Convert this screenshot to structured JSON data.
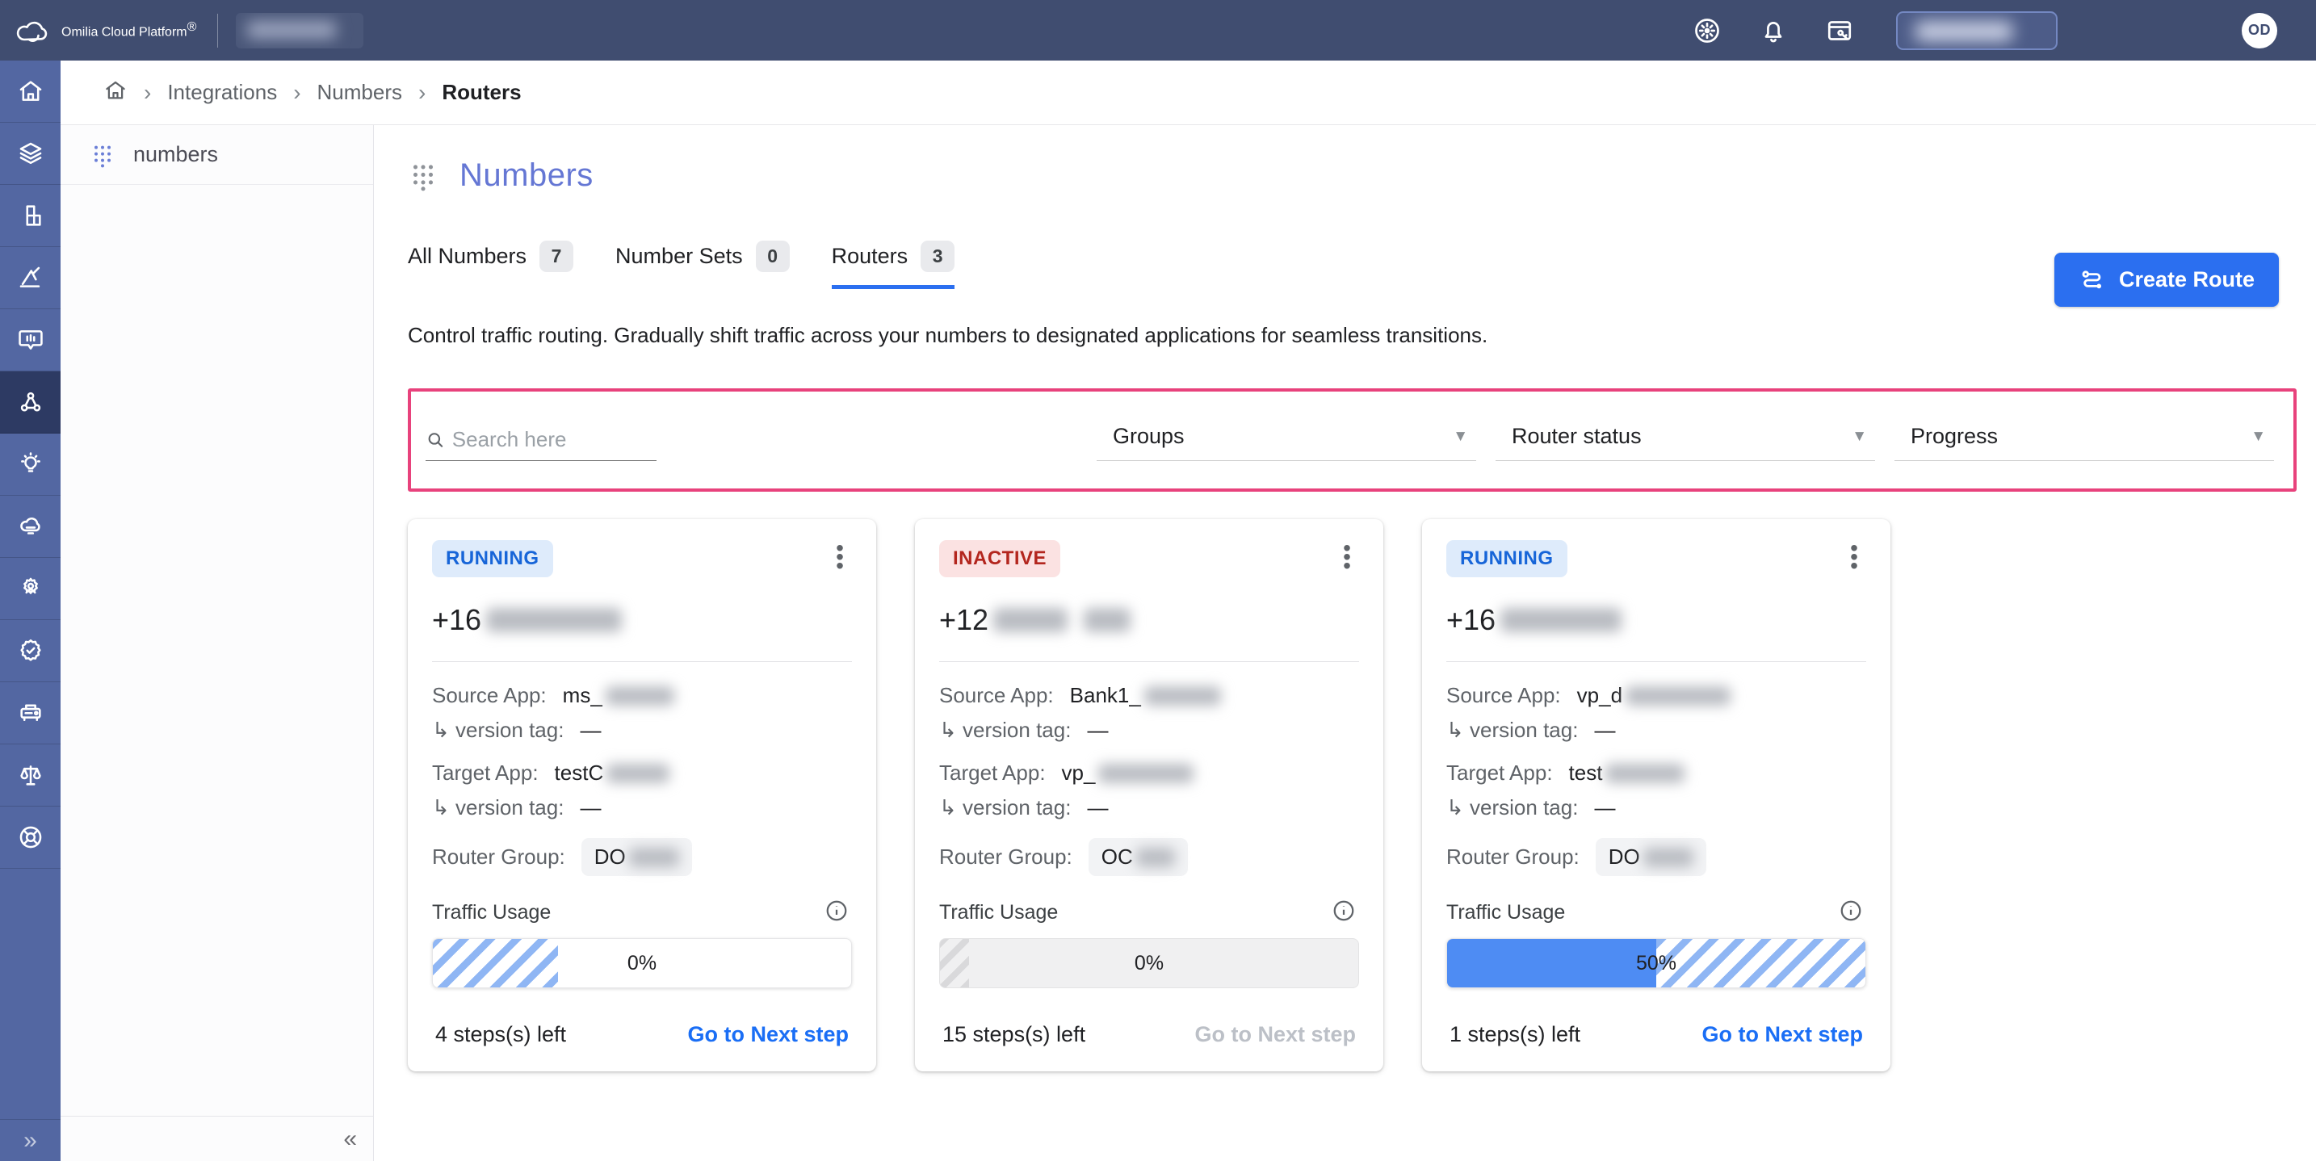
{
  "topbar": {
    "brand": "Omilia Cloud Platform",
    "brand_mark": "®",
    "avatar_initials": "OD",
    "icons": [
      "apps-wheel",
      "notifications-bell",
      "window-key"
    ]
  },
  "breadcrumb": {
    "separator": "›",
    "items": [
      "Integrations",
      "Numbers",
      "Routers"
    ]
  },
  "rail": {
    "icons": [
      "home",
      "layers",
      "blocks",
      "vector-triangle",
      "chat-insights",
      "network",
      "lightbulb",
      "cloud",
      "user-gear",
      "badge-check",
      "machine",
      "scales",
      "lifebuoy"
    ],
    "active": "network",
    "expand_glyph": "»"
  },
  "subsidebar": {
    "title": "numbers",
    "collapse_glyph": "«"
  },
  "page": {
    "title": "Numbers",
    "tabs": [
      {
        "label": "All Numbers",
        "count": "7"
      },
      {
        "label": "Number Sets",
        "count": "0"
      },
      {
        "label": "Routers",
        "count": "3"
      }
    ],
    "active_tab": "Routers",
    "description": "Control traffic routing. Gradually shift traffic across your numbers to designated applications for seamless transitions.",
    "create_button": "Create Route"
  },
  "filters": {
    "search_placeholder": "Search here",
    "groups_label": "Groups",
    "status_label": "Router status",
    "progress_label": "Progress",
    "arrow_glyph": "▼",
    "highlight_color": "#e8427c"
  },
  "card_labels": {
    "source": "Source App:",
    "target": "Target App:",
    "version_arrow": "↳",
    "version": "version tag:",
    "dash": "—",
    "group": "Router Group:",
    "traffic": "Traffic Usage"
  },
  "cards": [
    {
      "status": "RUNNING",
      "phone_prefix": "+16",
      "source_prefix": "ms_",
      "target_prefix": "testC",
      "group_prefix": "DO",
      "traffic_pct_label": "0%",
      "fill_pct": 0,
      "hatch_pct": 30,
      "steps_left": "4 steps(s) left",
      "next_label": "Go to Next step",
      "next_enabled": true
    },
    {
      "status": "INACTIVE",
      "phone_prefix": "+12",
      "source_prefix": "Bank1_",
      "target_prefix": "vp_",
      "group_prefix": "OC",
      "traffic_pct_label": "0%",
      "fill_pct": 0,
      "hatch_pct": 7,
      "steps_left": "15 steps(s) left",
      "next_label": "Go to Next step",
      "next_enabled": false
    },
    {
      "status": "RUNNING",
      "phone_prefix": "+16",
      "source_prefix": "vp_d",
      "target_prefix": "test",
      "group_prefix": "DO",
      "traffic_pct_label": "50%",
      "fill_pct": 50,
      "hatch_pct": 50,
      "steps_left": "1 steps(s) left",
      "next_label": "Go to Next step",
      "next_enabled": true
    }
  ]
}
